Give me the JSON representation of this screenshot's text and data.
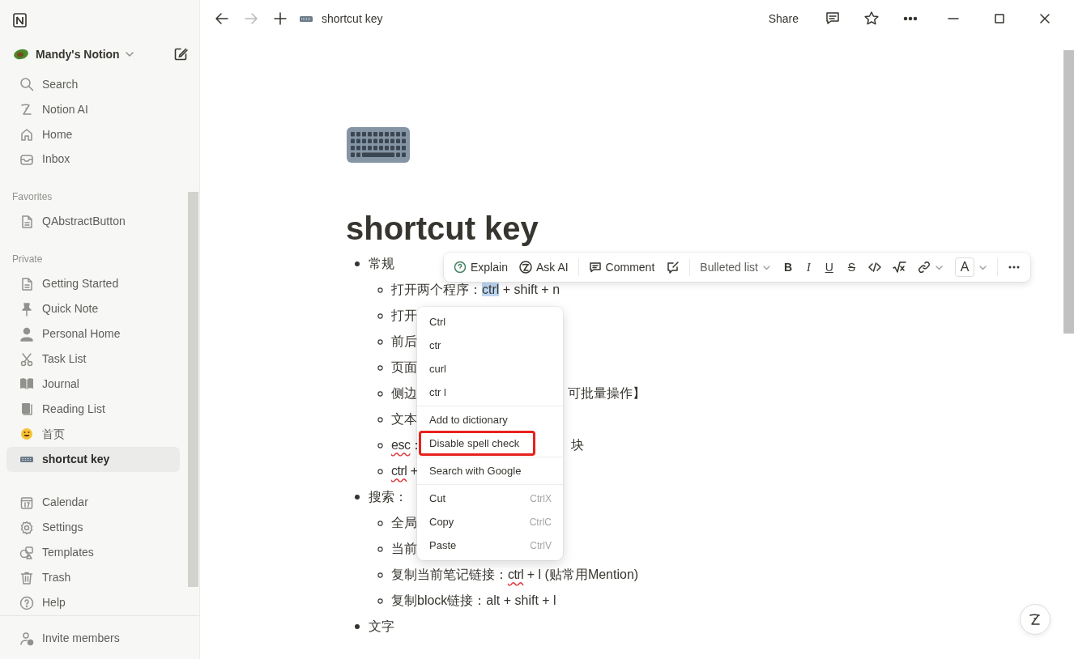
{
  "sidebar": {
    "workspace": "Mandy's Notion",
    "nav": [
      {
        "label": "Search"
      },
      {
        "label": "Notion AI"
      },
      {
        "label": "Home"
      },
      {
        "label": "Inbox"
      }
    ],
    "sections": [
      {
        "title": "Favorites",
        "items": [
          {
            "label": "QAbstractButton",
            "selected": false
          }
        ]
      },
      {
        "title": "Private",
        "items": [
          {
            "label": "Getting Started",
            "selected": false
          },
          {
            "label": "Quick Note",
            "selected": false
          },
          {
            "label": "Personal Home",
            "selected": false
          },
          {
            "label": "Task List",
            "selected": false
          },
          {
            "label": "Journal",
            "selected": false
          },
          {
            "label": "Reading List",
            "selected": false
          },
          {
            "label": "首页",
            "selected": false
          },
          {
            "label": "shortcut key",
            "selected": true
          }
        ]
      }
    ],
    "tools": [
      {
        "label": "Calendar"
      },
      {
        "label": "Settings"
      },
      {
        "label": "Templates"
      },
      {
        "label": "Trash"
      },
      {
        "label": "Help"
      }
    ],
    "footer": "Invite members"
  },
  "topbar": {
    "breadcrumb": "shortcut key",
    "share": "Share"
  },
  "page": {
    "title": "shortcut key",
    "blocks": [
      {
        "parts": [
          {
            "text": "常规"
          }
        ],
        "children": [
          {
            "parts": [
              {
                "text": "打开两个程序："
              },
              {
                "text": "ctrl",
                "highlighted": true
              },
              {
                "text": " + shift + n"
              }
            ]
          },
          {
            "parts": [
              {
                "text": "打开"
              }
            ]
          },
          {
            "parts": [
              {
                "text": "前后"
              }
            ]
          },
          {
            "parts": [
              {
                "text": "页面"
              }
            ]
          },
          {
            "parts": [
              {
                "text": "侧边"
              }
            ],
            "tail": "可批量操作】"
          },
          {
            "parts": [
              {
                "text": "文本"
              }
            ]
          },
          {
            "parts": [
              {
                "text": "esc",
                "misspelled": true
              },
              {
                "text": "："
              }
            ],
            "tail": "块"
          },
          {
            "parts": [
              {
                "text": "ctrl",
                "misspelled": true
              },
              {
                "text": " +"
              }
            ]
          }
        ]
      },
      {
        "parts": [
          {
            "text": "搜索："
          }
        ],
        "children": [
          {
            "parts": [
              {
                "text": "全局"
              }
            ]
          },
          {
            "parts": [
              {
                "text": "当前"
              }
            ]
          },
          {
            "parts": [
              {
                "text": "复制当前笔记链接："
              },
              {
                "text": "ctrl",
                "misspelled": true
              },
              {
                "text": " + l (贴常用Mention)"
              }
            ]
          },
          {
            "parts": [
              {
                "text": "复制block链接：alt + shift + l"
              }
            ]
          }
        ]
      },
      {
        "parts": [
          {
            "text": "文字"
          }
        ]
      }
    ]
  },
  "toolbar": {
    "buttons": [
      {
        "label": "Explain"
      },
      {
        "label": "Ask AI"
      },
      {
        "label": "Comment"
      }
    ],
    "block_type": "Bulleted list",
    "formats": [
      "B",
      "I",
      "U",
      "S"
    ],
    "color_label": "A"
  },
  "context_menu": {
    "groups": [
      {
        "items": [
          {
            "label": "Ctrl"
          },
          {
            "label": "ctr"
          },
          {
            "label": "curl"
          },
          {
            "label": "ctr l"
          }
        ]
      },
      {
        "items": [
          {
            "label": "Add to dictionary",
            "outlined": false
          },
          {
            "label": "Disable spell check",
            "outlined": true
          }
        ]
      },
      {
        "items": [
          {
            "label": "Search with Google"
          }
        ]
      },
      {
        "items": [
          {
            "label": "Cut",
            "shortcut": "CtrlX"
          },
          {
            "label": "Copy",
            "shortcut": "CtrlC"
          },
          {
            "label": "Paste",
            "shortcut": "CtrlV"
          }
        ]
      }
    ]
  }
}
